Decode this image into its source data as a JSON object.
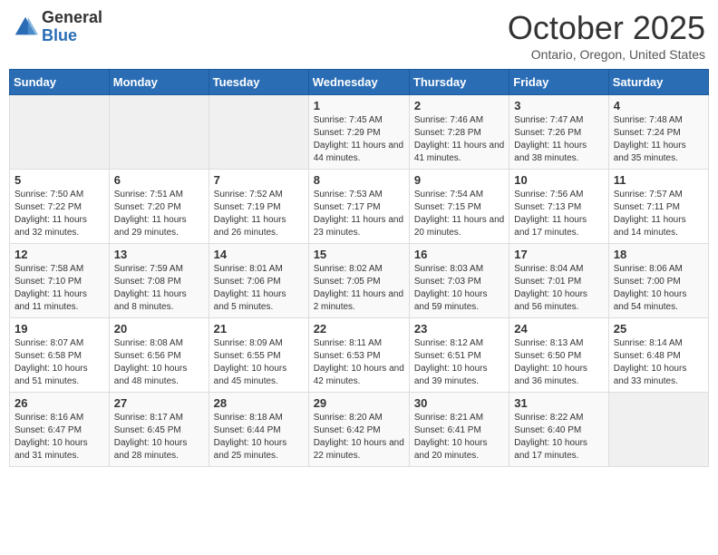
{
  "header": {
    "logo_general": "General",
    "logo_blue": "Blue",
    "month": "October 2025",
    "location": "Ontario, Oregon, United States"
  },
  "weekdays": [
    "Sunday",
    "Monday",
    "Tuesday",
    "Wednesday",
    "Thursday",
    "Friday",
    "Saturday"
  ],
  "weeks": [
    [
      {
        "day": "",
        "info": ""
      },
      {
        "day": "",
        "info": ""
      },
      {
        "day": "",
        "info": ""
      },
      {
        "day": "1",
        "info": "Sunrise: 7:45 AM\nSunset: 7:29 PM\nDaylight: 11 hours and 44 minutes."
      },
      {
        "day": "2",
        "info": "Sunrise: 7:46 AM\nSunset: 7:28 PM\nDaylight: 11 hours and 41 minutes."
      },
      {
        "day": "3",
        "info": "Sunrise: 7:47 AM\nSunset: 7:26 PM\nDaylight: 11 hours and 38 minutes."
      },
      {
        "day": "4",
        "info": "Sunrise: 7:48 AM\nSunset: 7:24 PM\nDaylight: 11 hours and 35 minutes."
      }
    ],
    [
      {
        "day": "5",
        "info": "Sunrise: 7:50 AM\nSunset: 7:22 PM\nDaylight: 11 hours and 32 minutes."
      },
      {
        "day": "6",
        "info": "Sunrise: 7:51 AM\nSunset: 7:20 PM\nDaylight: 11 hours and 29 minutes."
      },
      {
        "day": "7",
        "info": "Sunrise: 7:52 AM\nSunset: 7:19 PM\nDaylight: 11 hours and 26 minutes."
      },
      {
        "day": "8",
        "info": "Sunrise: 7:53 AM\nSunset: 7:17 PM\nDaylight: 11 hours and 23 minutes."
      },
      {
        "day": "9",
        "info": "Sunrise: 7:54 AM\nSunset: 7:15 PM\nDaylight: 11 hours and 20 minutes."
      },
      {
        "day": "10",
        "info": "Sunrise: 7:56 AM\nSunset: 7:13 PM\nDaylight: 11 hours and 17 minutes."
      },
      {
        "day": "11",
        "info": "Sunrise: 7:57 AM\nSunset: 7:11 PM\nDaylight: 11 hours and 14 minutes."
      }
    ],
    [
      {
        "day": "12",
        "info": "Sunrise: 7:58 AM\nSunset: 7:10 PM\nDaylight: 11 hours and 11 minutes."
      },
      {
        "day": "13",
        "info": "Sunrise: 7:59 AM\nSunset: 7:08 PM\nDaylight: 11 hours and 8 minutes."
      },
      {
        "day": "14",
        "info": "Sunrise: 8:01 AM\nSunset: 7:06 PM\nDaylight: 11 hours and 5 minutes."
      },
      {
        "day": "15",
        "info": "Sunrise: 8:02 AM\nSunset: 7:05 PM\nDaylight: 11 hours and 2 minutes."
      },
      {
        "day": "16",
        "info": "Sunrise: 8:03 AM\nSunset: 7:03 PM\nDaylight: 10 hours and 59 minutes."
      },
      {
        "day": "17",
        "info": "Sunrise: 8:04 AM\nSunset: 7:01 PM\nDaylight: 10 hours and 56 minutes."
      },
      {
        "day": "18",
        "info": "Sunrise: 8:06 AM\nSunset: 7:00 PM\nDaylight: 10 hours and 54 minutes."
      }
    ],
    [
      {
        "day": "19",
        "info": "Sunrise: 8:07 AM\nSunset: 6:58 PM\nDaylight: 10 hours and 51 minutes."
      },
      {
        "day": "20",
        "info": "Sunrise: 8:08 AM\nSunset: 6:56 PM\nDaylight: 10 hours and 48 minutes."
      },
      {
        "day": "21",
        "info": "Sunrise: 8:09 AM\nSunset: 6:55 PM\nDaylight: 10 hours and 45 minutes."
      },
      {
        "day": "22",
        "info": "Sunrise: 8:11 AM\nSunset: 6:53 PM\nDaylight: 10 hours and 42 minutes."
      },
      {
        "day": "23",
        "info": "Sunrise: 8:12 AM\nSunset: 6:51 PM\nDaylight: 10 hours and 39 minutes."
      },
      {
        "day": "24",
        "info": "Sunrise: 8:13 AM\nSunset: 6:50 PM\nDaylight: 10 hours and 36 minutes."
      },
      {
        "day": "25",
        "info": "Sunrise: 8:14 AM\nSunset: 6:48 PM\nDaylight: 10 hours and 33 minutes."
      }
    ],
    [
      {
        "day": "26",
        "info": "Sunrise: 8:16 AM\nSunset: 6:47 PM\nDaylight: 10 hours and 31 minutes."
      },
      {
        "day": "27",
        "info": "Sunrise: 8:17 AM\nSunset: 6:45 PM\nDaylight: 10 hours and 28 minutes."
      },
      {
        "day": "28",
        "info": "Sunrise: 8:18 AM\nSunset: 6:44 PM\nDaylight: 10 hours and 25 minutes."
      },
      {
        "day": "29",
        "info": "Sunrise: 8:20 AM\nSunset: 6:42 PM\nDaylight: 10 hours and 22 minutes."
      },
      {
        "day": "30",
        "info": "Sunrise: 8:21 AM\nSunset: 6:41 PM\nDaylight: 10 hours and 20 minutes."
      },
      {
        "day": "31",
        "info": "Sunrise: 8:22 AM\nSunset: 6:40 PM\nDaylight: 10 hours and 17 minutes."
      },
      {
        "day": "",
        "info": ""
      }
    ]
  ]
}
